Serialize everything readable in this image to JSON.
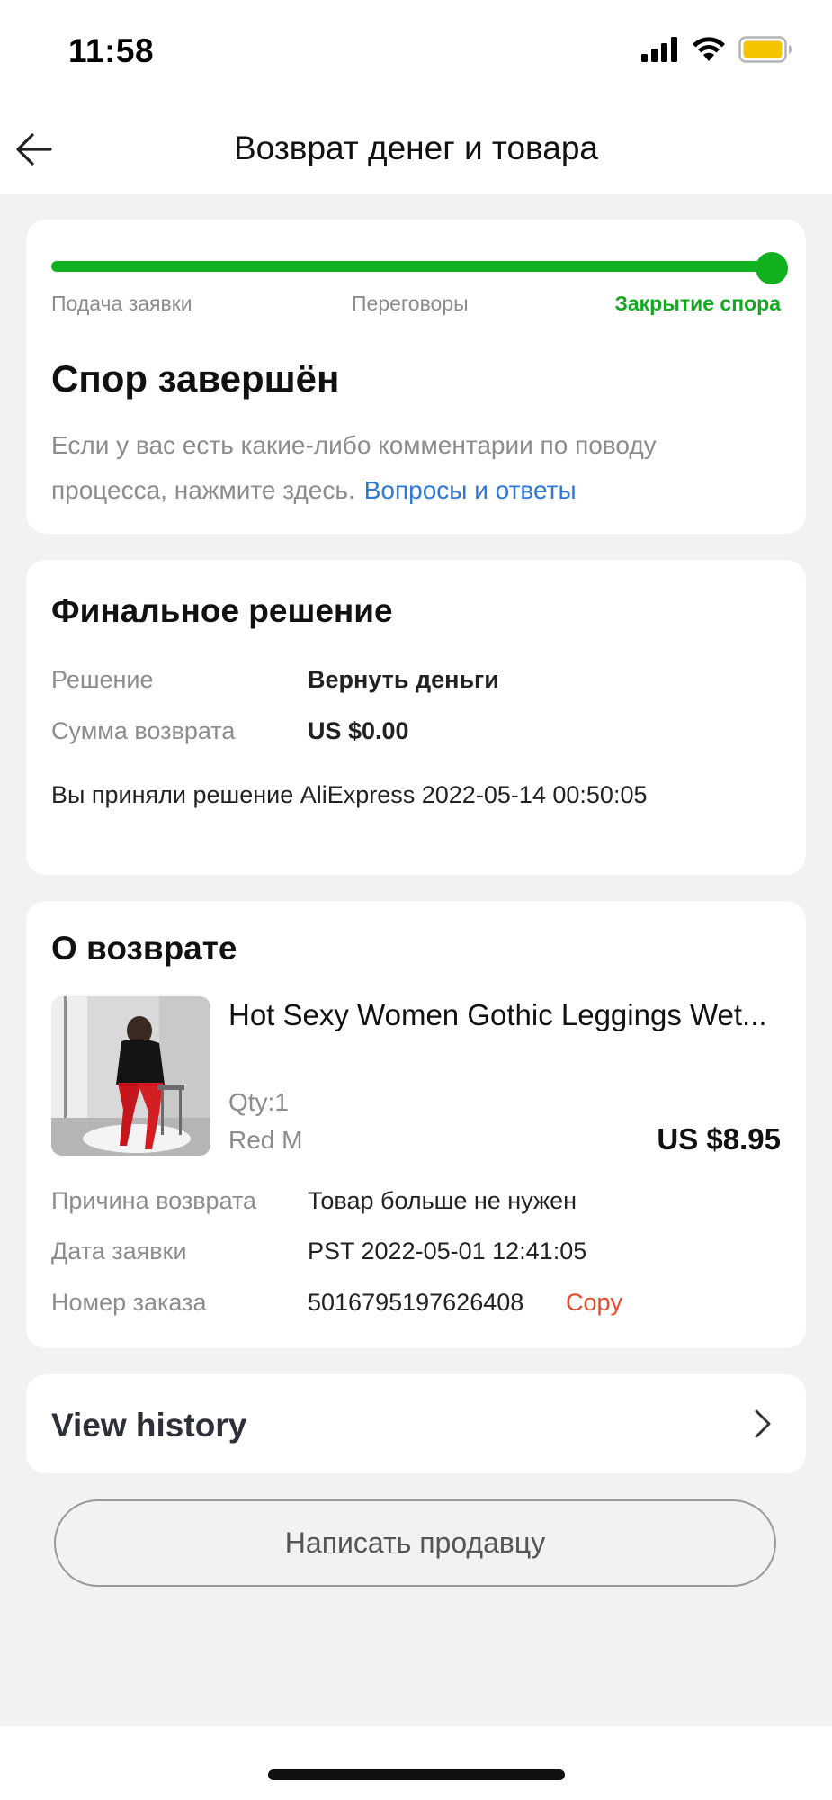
{
  "status_bar": {
    "time": "11:58",
    "signal_icon": "cellular-signal-icon",
    "wifi_icon": "wifi-icon",
    "battery_icon": "battery-icon",
    "battery_color": "#f5c400"
  },
  "header": {
    "back_icon": "arrow-left-icon",
    "title": "Возврат денег и товара"
  },
  "progress": {
    "steps": [
      "Подача заявки",
      "Переговоры",
      "Закрытие спора"
    ],
    "active_step": 3,
    "progress_fraction": 1.0,
    "accent_color": "#10b11f"
  },
  "dispute": {
    "heading": "Спор завершён",
    "description": "Если у вас есть какие-либо комментарии по поводу процесса, нажмите здесь.",
    "link": "Вопросы и ответы",
    "link_color": "#2f78d6"
  },
  "final_decision": {
    "heading": "Финальное решение",
    "decision_label": "Решение",
    "decision_value": "Вернуть деньги",
    "amount_label": "Сумма возврата",
    "amount_value": "US $0.00",
    "accepted_text": "Вы приняли решение AliExpress 2022-05-14 00:50:05"
  },
  "about_return": {
    "heading": "О возврате",
    "product": {
      "name": "Hot Sexy Women Gothic Leggings Wet...",
      "qty": "Qty:1",
      "variant": "Red M",
      "price": "US $8.95"
    },
    "reason_label": "Причина возврата",
    "reason_value": "Товар больше не нужен",
    "date_label": "Дата заявки",
    "date_value": "PST 2022-05-01 12:41:05",
    "order_label": "Номер заказа",
    "order_value": "5016795197626408",
    "copy_label": "Copy",
    "copy_color": "#e8492c"
  },
  "history": {
    "label": "View history",
    "chevron_icon": "chevron-right-icon"
  },
  "contact_button": {
    "label": "Написать продавцу"
  }
}
